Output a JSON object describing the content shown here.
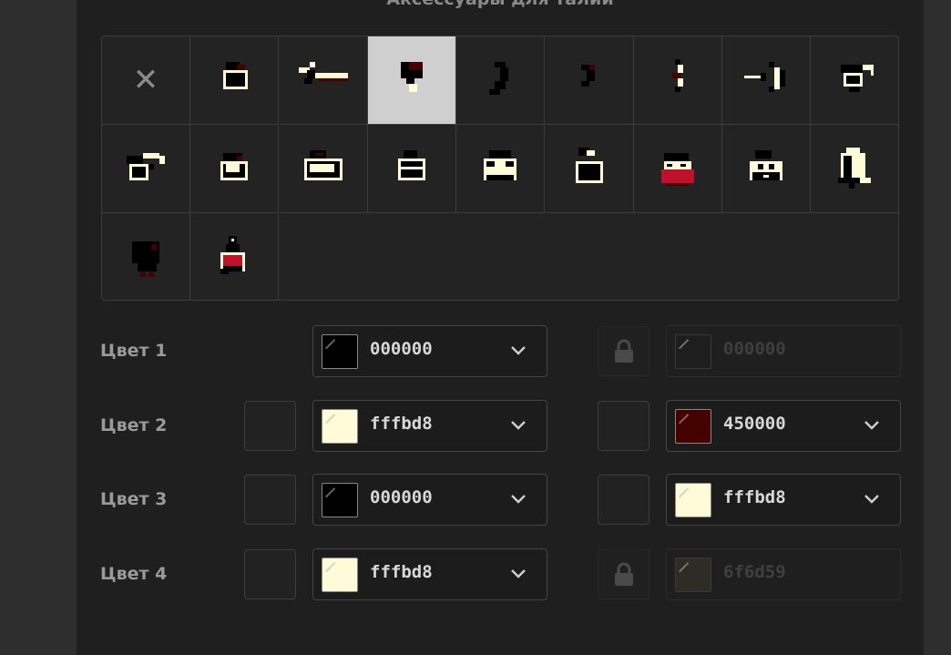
{
  "panel": {
    "title": "Аксессуары для талии"
  },
  "accessories": {
    "selected_index": 3,
    "items": [
      {
        "icon": "none-icon",
        "glyph": "✕"
      },
      {
        "icon": "small-pouch-icon"
      },
      {
        "icon": "sword-icon"
      },
      {
        "icon": "flask-icon"
      },
      {
        "icon": "horn-icon"
      },
      {
        "icon": "small-horn-icon"
      },
      {
        "icon": "bow-small-icon"
      },
      {
        "icon": "bow-icon"
      },
      {
        "icon": "round-bag-icon"
      },
      {
        "icon": "satchel-icon"
      },
      {
        "icon": "pouch-icon"
      },
      {
        "icon": "wide-pouch-icon"
      },
      {
        "icon": "box-bag-icon"
      },
      {
        "icon": "cream-bag-icon"
      },
      {
        "icon": "ring-bottle-icon"
      },
      {
        "icon": "red-pouch-icon"
      },
      {
        "icon": "double-pouch-icon"
      },
      {
        "icon": "bell-icon"
      },
      {
        "icon": "shadow-pouch-icon"
      },
      {
        "icon": "potion-icon"
      }
    ]
  },
  "color_rows": [
    {
      "label": "Цвет 1",
      "left": {
        "swatch": null,
        "hex": "000000",
        "color": "#000000",
        "disabled": false
      },
      "right": {
        "locked": true,
        "hex": "000000",
        "color": "#1e1e1e",
        "disabled": true
      }
    },
    {
      "label": "Цвет 2",
      "left": {
        "swatch": true,
        "hex": "fffbd8",
        "color": "#fffbd8",
        "disabled": false
      },
      "right": {
        "locked": false,
        "hex": "450000",
        "color": "#450000",
        "disabled": false
      }
    },
    {
      "label": "Цвет 3",
      "left": {
        "swatch": true,
        "hex": "000000",
        "color": "#000000",
        "disabled": false
      },
      "right": {
        "locked": false,
        "hex": "fffbd8",
        "color": "#fffbd8",
        "disabled": false
      }
    },
    {
      "label": "Цвет 4",
      "left": {
        "swatch": true,
        "hex": "fffbd8",
        "color": "#fffbd8",
        "disabled": false
      },
      "right": {
        "locked": true,
        "hex": "6f6d59",
        "color": "#2d2c25",
        "disabled": true
      }
    }
  ],
  "colors": {
    "panel_bg": "#1f1f1f",
    "selected_cell": "#cfcfcf",
    "cream": "#fffbd8",
    "dark_red": "#450000",
    "accent_red": "#c0102a"
  }
}
